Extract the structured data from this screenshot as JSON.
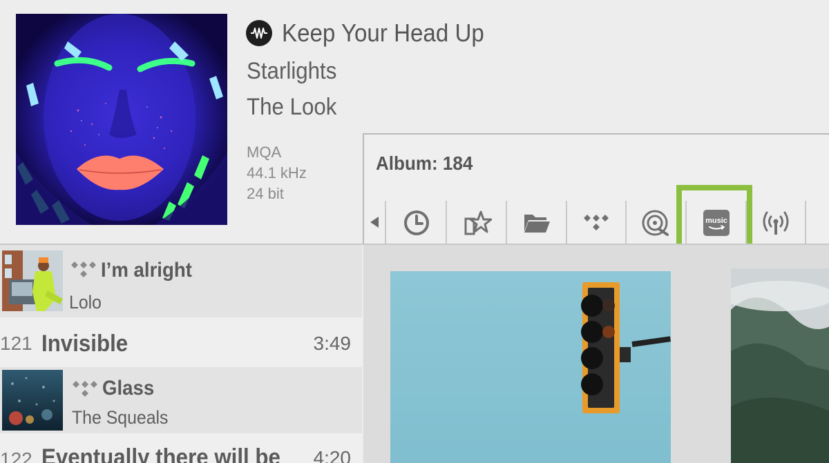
{
  "now_playing": {
    "title": "Keep Your Head Up",
    "artist": "Starlights",
    "album": "The Look",
    "format": "MQA",
    "sample_rate": "44.1 kHz",
    "bit_depth": "24 bit",
    "source_icon": "mqa-waveform-icon"
  },
  "browser": {
    "title": "Album: 184",
    "tabs": [
      {
        "icon": "recent-clock-icon"
      },
      {
        "icon": "favorites-star-icon"
      },
      {
        "icon": "folder-icon"
      },
      {
        "icon": "tidal-icon"
      },
      {
        "icon": "cd-rip-icon"
      },
      {
        "icon": "amazon-music-icon",
        "label": "music",
        "selected": true
      },
      {
        "icon": "radio-broadcast-icon"
      }
    ],
    "highlight_color": "#8cbf3f"
  },
  "queue": [
    {
      "title": "I’m alright",
      "artist": "Lolo",
      "source": "tidal"
    },
    {
      "number": "121",
      "title": "Invisible",
      "duration": "3:49"
    },
    {
      "title": "Glass",
      "artist": "The Squeals",
      "source": "tidal"
    },
    {
      "number": "122",
      "title": "Eventually there will be",
      "duration": "4:20"
    }
  ]
}
